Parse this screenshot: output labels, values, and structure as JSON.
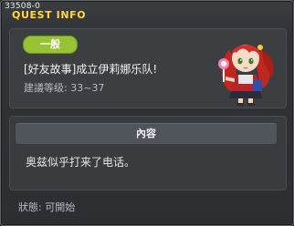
{
  "window": {
    "quest_id": "33508-0",
    "title": "QUEST INFO"
  },
  "quest": {
    "category_tag": "一般",
    "name": "[好友故事]成立伊莉娜乐队!",
    "level_label": "建議等级:",
    "level_range": "33~37",
    "npc_portrait_icon": "red-haired-girl-npc-icon"
  },
  "content": {
    "header": "內容",
    "text": "奥兹似乎打来了电话。"
  },
  "status": {
    "label": "狀態:",
    "value": "可開始"
  },
  "colors": {
    "title_yellow": "#ffd84a",
    "tag_green": "#97c234",
    "panel_bg": "#3b3f42"
  }
}
